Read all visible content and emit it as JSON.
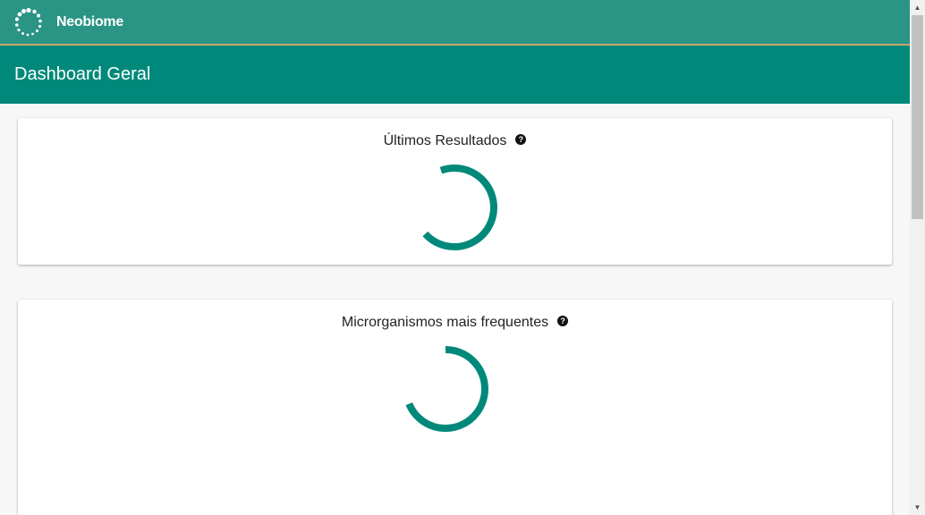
{
  "app": {
    "brand_name": "Neobiome",
    "logo_icon": "neobiome-logo-icon"
  },
  "header": {
    "title": "Dashboard Geral"
  },
  "cards": [
    {
      "title": "Últimos Resultados",
      "help_icon": "help-circle-icon",
      "state": "loading"
    },
    {
      "title": "Microrganismos mais frequentes",
      "help_icon": "help-circle-icon",
      "state": "loading"
    }
  ],
  "colors": {
    "topbar": "#2a9485",
    "header": "#00897b",
    "accent_line": "#c8a86a",
    "spinner": "#00897b"
  },
  "scrollbar": {
    "up_arrow": "▲",
    "down_arrow": "▼"
  }
}
